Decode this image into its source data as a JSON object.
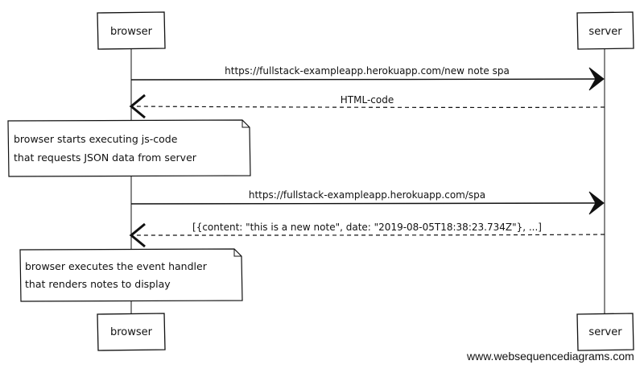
{
  "participants": {
    "browser": "browser",
    "server": "server"
  },
  "messages": [
    {
      "from": "browser",
      "to": "server",
      "label": "https://fullstack-exampleapp.herokuapp.com/new note spa",
      "style": "solid"
    },
    {
      "from": "server",
      "to": "browser",
      "label": "HTML-code",
      "style": "dashed"
    },
    {
      "from": "browser",
      "to": "server",
      "label": "https://fullstack-exampleapp.herokuapp.com/spa",
      "style": "solid"
    },
    {
      "from": "server",
      "to": "browser",
      "label": "[{content: \"this is a new note\", date: \"2019-08-05T18:38:23.734Z\"}, ...]",
      "style": "dashed"
    }
  ],
  "notes": [
    {
      "lines": [
        "browser starts executing js-code",
        "that requests JSON data from server"
      ]
    },
    {
      "lines": [
        "browser executes the event handler",
        "that renders notes to display"
      ]
    }
  ],
  "watermark": "www.websequencediagrams.com",
  "colors": {
    "stroke": "#111111",
    "background": "#ffffff"
  }
}
